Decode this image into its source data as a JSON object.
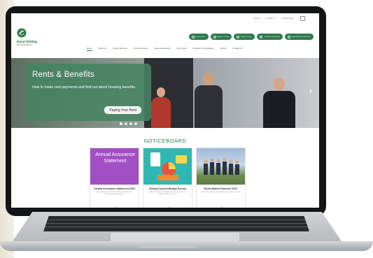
{
  "topbar": {
    "links": [
      "Careers",
      "Contact Us",
      "Translate Page"
    ]
  },
  "logo": {
    "name": "Rural Stirling",
    "subtitle": "Housing Association"
  },
  "quick_links": [
    "Pay Your Rent",
    "Apply for a Home",
    "Report a Repair",
    "Complaints & Feedback",
    "Report Antisocial Behaviour"
  ],
  "nav": {
    "items": [
      "Home",
      "About Us",
      "Tenant Services",
      "Finding a Home",
      "News and Events",
      "Your Views",
      "Freedom of Information",
      "Library",
      "Contact Us"
    ],
    "active": "Home"
  },
  "hero": {
    "title": "Rents & Benefits",
    "description": "How to make rent payments and find out about housing benefits.",
    "button_label": "Paying Your Rent",
    "slide_count": 4,
    "active_slide": 1
  },
  "noticeboard": {
    "title": "NOTICEBOARD",
    "cards": [
      {
        "image_text": "Annual Assurance Statement",
        "title": "Annual Assurance Statement 2023",
        "text": "Annual Assurance Statement 2023 submitted to the Scottish Housing Regulator"
      },
      {
        "image_text": "",
        "title": "Stirling Council Budget Survey",
        "text": "Stirling Council are seeking views from tenants on the budget priorities for the year"
      },
      {
        "image_text": "",
        "title": "Rural Matters Summer 2023",
        "text": "The summer edition of Rural Matters newsletter is out now"
      }
    ],
    "arrow": "→"
  },
  "colors": {
    "brand_green": "#2e7b4f",
    "hero_card": "#468462",
    "purple_card": "#a34fc4",
    "teal_card": "#2fb8b2"
  }
}
